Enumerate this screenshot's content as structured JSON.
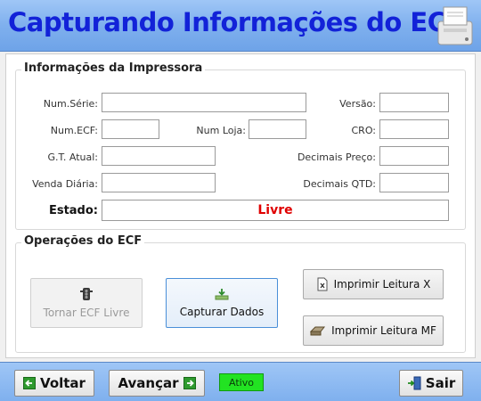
{
  "header": {
    "title": "Capturando Informações do ECF",
    "icon": "printer-icon"
  },
  "printer_info": {
    "title": "Informações da Impressora",
    "num_serie": {
      "label": "Num.Série:",
      "value": ""
    },
    "versao": {
      "label": "Versão:",
      "value": ""
    },
    "num_ecf": {
      "label": "Num.ECF:",
      "value": ""
    },
    "num_loja": {
      "label": "Num Loja:",
      "value": ""
    },
    "cro": {
      "label": "CRO:",
      "value": ""
    },
    "gt_atual": {
      "label": "G.T. Atual:",
      "value": ""
    },
    "decimais_preco": {
      "label": "Decimais Preço:",
      "value": ""
    },
    "venda_diaria": {
      "label": "Venda Diária:",
      "value": ""
    },
    "decimais_qtd": {
      "label": "Decimais QTD:",
      "value": ""
    },
    "estado": {
      "label": "Estado:",
      "value": "Livre",
      "color": "#e00000"
    }
  },
  "operations": {
    "title": "Operações do ECF",
    "tornar_livre": {
      "label": "Tornar ECF Livre",
      "icon": "traffic-light-icon",
      "enabled": false
    },
    "capturar_dados": {
      "label": "Capturar Dados",
      "icon": "download-tray-icon"
    },
    "leitura_x": {
      "label": "Imprimir Leitura X",
      "icon": "document-x-icon"
    },
    "leitura_mf": {
      "label": "Imprimir Leitura MF",
      "icon": "printer-small-icon"
    }
  },
  "footer": {
    "voltar": {
      "label": "Voltar",
      "icon": "arrow-left-icon"
    },
    "avancar": {
      "label": "Avançar",
      "icon": "arrow-right-icon"
    },
    "status": {
      "label": "Ativo",
      "color": "#22e322"
    },
    "sair": {
      "label": "Sair",
      "icon": "exit-door-icon"
    }
  },
  "colors": {
    "header_bg": "#7fb0ee",
    "title": "#1222d8",
    "estado": "#e00000"
  }
}
